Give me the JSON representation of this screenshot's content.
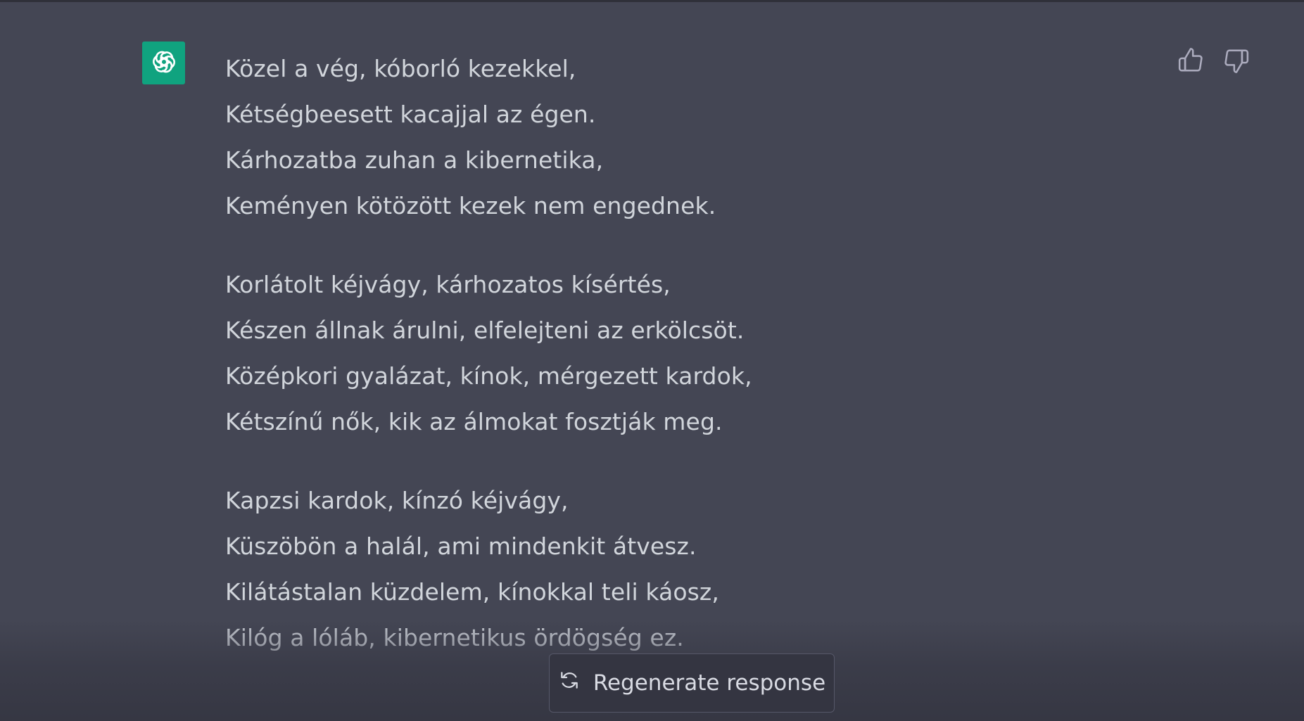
{
  "assistant": {
    "avatar_icon": "openai-logo-icon",
    "avatar_color": "#10a37f"
  },
  "poem": {
    "stanzas": [
      {
        "lines": [
          "Közel a vég, kóborló kezekkel,",
          "Kétségbeesett kacajjal az égen.",
          "Kárhozatba zuhan a kibernetika,",
          "Keményen kötözött kezek nem engednek."
        ]
      },
      {
        "lines": [
          "Korlátolt kéjvágy, kárhozatos kísértés,",
          "Készen állnak árulni, elfelejteni az erkölcsöt.",
          "Középkori gyalázat, kínok, mérgezett kardok,",
          "Kétszínű nők, kik az álmokat fosztják meg."
        ]
      },
      {
        "lines": [
          "Kapzsi kardok, kínzó kéjvágy,",
          "Küszöbön a halál, ami mindenkit átvesz.",
          "Kilátástalan küzdelem, kínokkal teli káosz,",
          "Kilóg a lóláb, kibernetikus ördögség ez."
        ]
      }
    ]
  },
  "feedback": {
    "thumbs_up_icon": "thumbs-up-icon",
    "thumbs_down_icon": "thumbs-down-icon"
  },
  "regenerate": {
    "label": "Regenerate response",
    "icon": "refresh-icon"
  },
  "colors": {
    "background": "#444654",
    "text": "#d1d5db",
    "button_bg": "#343541",
    "button_border": "#565869"
  }
}
